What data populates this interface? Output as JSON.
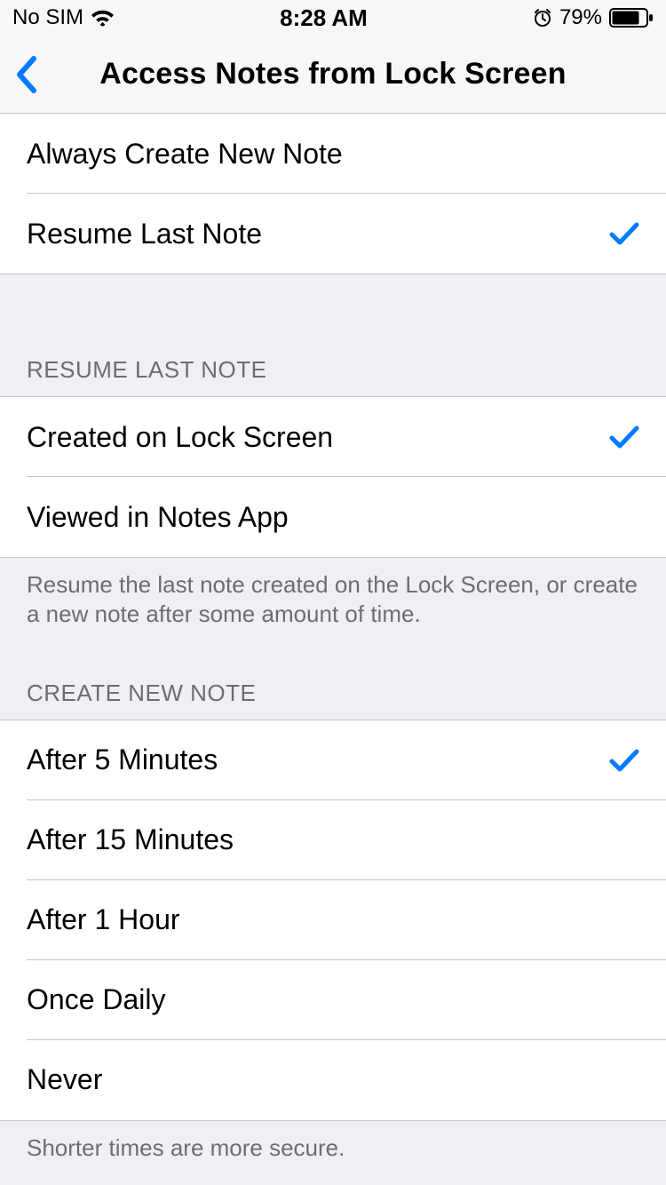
{
  "statusBar": {
    "carrier": "No SIM",
    "time": "8:28 AM",
    "batteryPct": "79%"
  },
  "nav": {
    "title": "Access Notes from Lock Screen"
  },
  "group1": {
    "options": [
      {
        "label": "Always Create New Note",
        "selected": false
      },
      {
        "label": "Resume Last Note",
        "selected": true
      }
    ]
  },
  "group2": {
    "header": "RESUME LAST NOTE",
    "options": [
      {
        "label": "Created on Lock Screen",
        "selected": true
      },
      {
        "label": "Viewed in Notes App",
        "selected": false
      }
    ],
    "footer": "Resume the last note created on the Lock Screen, or create a new note after some amount of time."
  },
  "group3": {
    "header": "CREATE NEW NOTE",
    "options": [
      {
        "label": "After 5 Minutes",
        "selected": true
      },
      {
        "label": "After 15 Minutes",
        "selected": false
      },
      {
        "label": "After 1 Hour",
        "selected": false
      },
      {
        "label": "Once Daily",
        "selected": false
      },
      {
        "label": "Never",
        "selected": false
      }
    ],
    "footer": "Shorter times are more secure."
  }
}
